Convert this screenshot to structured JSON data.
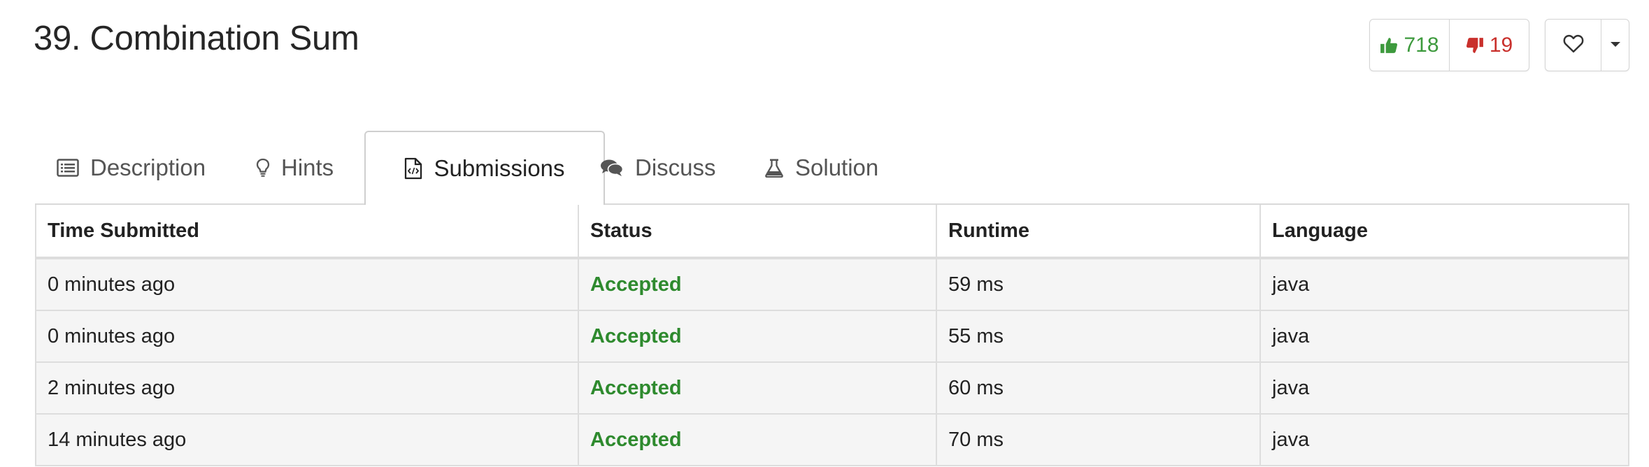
{
  "problem": {
    "title": "39. Combination Sum"
  },
  "votes": {
    "likes": "718",
    "dislikes": "19",
    "like_icon": "thumbs-up-icon",
    "dislike_icon": "thumbs-down-icon"
  },
  "favorite": {
    "icon": "heart-icon",
    "menu_icon": "caret-down-icon"
  },
  "tabs": [
    {
      "label": "Description",
      "icon": "list-alt-icon",
      "active": false
    },
    {
      "label": "Hints",
      "icon": "lightbulb-icon",
      "active": false
    },
    {
      "label": "Submissions",
      "icon": "file-code-icon",
      "active": true
    },
    {
      "label": "Discuss",
      "icon": "comments-icon",
      "active": false
    },
    {
      "label": "Solution",
      "icon": "flask-icon",
      "active": false
    }
  ],
  "table": {
    "headers": [
      "Time Submitted",
      "Status",
      "Runtime",
      "Language"
    ],
    "rows": [
      {
        "time": "0 minutes ago",
        "status": "Accepted",
        "runtime": "59 ms",
        "language": "java"
      },
      {
        "time": "0 minutes ago",
        "status": "Accepted",
        "runtime": "55 ms",
        "language": "java"
      },
      {
        "time": "2 minutes ago",
        "status": "Accepted",
        "runtime": "60 ms",
        "language": "java"
      },
      {
        "time": "14 minutes ago",
        "status": "Accepted",
        "runtime": "70 ms",
        "language": "java"
      }
    ]
  },
  "colors": {
    "accepted": "#2e8a2e",
    "like": "#3d9a3d",
    "dislike": "#c9302c"
  }
}
